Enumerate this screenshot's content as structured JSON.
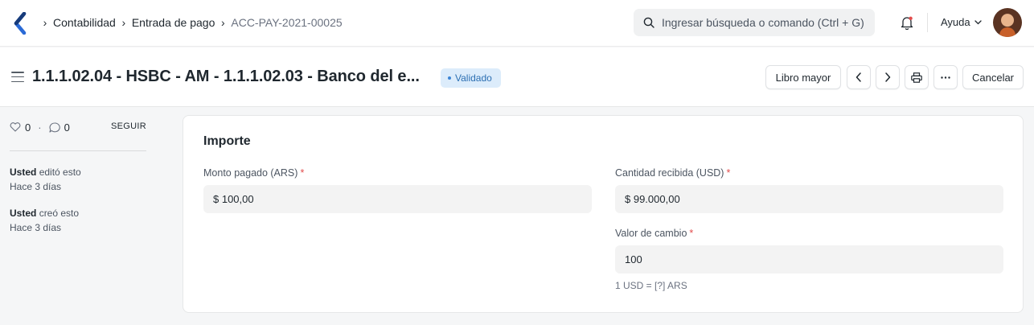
{
  "navbar": {
    "breadcrumbs": [
      "Contabilidad",
      "Entrada de pago",
      "ACC-PAY-2021-00025"
    ],
    "search_placeholder": "Ingresar búsqueda o comando (Ctrl + G)",
    "help_label": "Ayuda"
  },
  "header": {
    "title": "1.1.1.02.04 - HSBC - AM - 1.1.1.02.03 - Banco del e...",
    "status": "Validado",
    "status_color": "#dcecfb",
    "ledger_button": "Libro mayor",
    "cancel_button": "Cancelar"
  },
  "sidebar": {
    "likes": "0",
    "comments": "0",
    "follow_label": "SEGUIR",
    "activity": [
      {
        "user": "Usted",
        "action": "editó esto",
        "time": "Hace 3 días"
      },
      {
        "user": "Usted",
        "action": "creó esto",
        "time": "Hace 3 días"
      }
    ]
  },
  "form": {
    "section_title": "Importe",
    "paid_amount_label": "Monto pagado (ARS)",
    "paid_amount_value": "$ 100,00",
    "received_amount_label": "Cantidad recibida (USD)",
    "received_amount_value": "$ 99.000,00",
    "exchange_rate_label": "Valor de cambio",
    "exchange_rate_value": "100",
    "exchange_rate_hint": "1 USD = [?] ARS",
    "required_mark": "*"
  }
}
